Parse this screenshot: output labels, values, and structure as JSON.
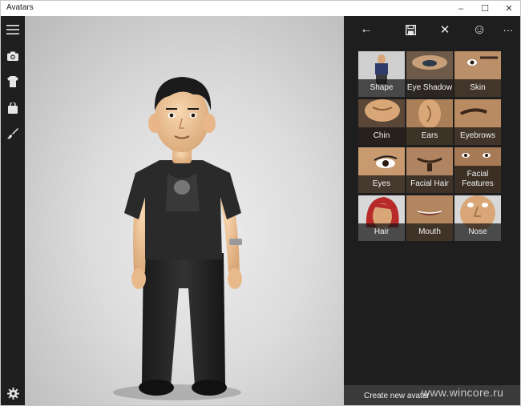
{
  "window": {
    "title": "Avatars",
    "minimize": "–",
    "maximize": "☐",
    "close": "✕"
  },
  "sidebar": {
    "items": [
      {
        "icon": "hamburger-menu-icon"
      },
      {
        "icon": "camera-icon"
      },
      {
        "icon": "shirt-icon"
      },
      {
        "icon": "shopping-bag-icon"
      },
      {
        "icon": "paintbrush-icon"
      },
      {
        "icon": "settings-gear-icon"
      }
    ]
  },
  "panel": {
    "toolbar": [
      {
        "icon": "back-arrow-icon",
        "label": "←"
      },
      {
        "icon": "save-icon"
      },
      {
        "icon": "close-icon",
        "label": "✕"
      },
      {
        "icon": "emotion-icon",
        "label": "☺"
      },
      {
        "icon": "more-icon",
        "label": "···"
      }
    ],
    "tiles": [
      {
        "label": "Shape"
      },
      {
        "label": "Eye Shadow"
      },
      {
        "label": "Skin"
      },
      {
        "label": "Chin"
      },
      {
        "label": "Ears"
      },
      {
        "label": "Eyebrows"
      },
      {
        "label": "Eyes"
      },
      {
        "label": "Facial Hair"
      },
      {
        "label": "Facial Features"
      },
      {
        "label": "Hair"
      },
      {
        "label": "Mouth"
      },
      {
        "label": "Nose"
      }
    ]
  },
  "create_button": {
    "label": "Create new avatar"
  },
  "watermark": {
    "text": "www.wincore.ru"
  },
  "colors": {
    "sidebar_bg": "#1f1f1f",
    "panel_bg": "#1e1e1e",
    "skin": "#f2c89b",
    "shirt": "#2a2a2a"
  }
}
